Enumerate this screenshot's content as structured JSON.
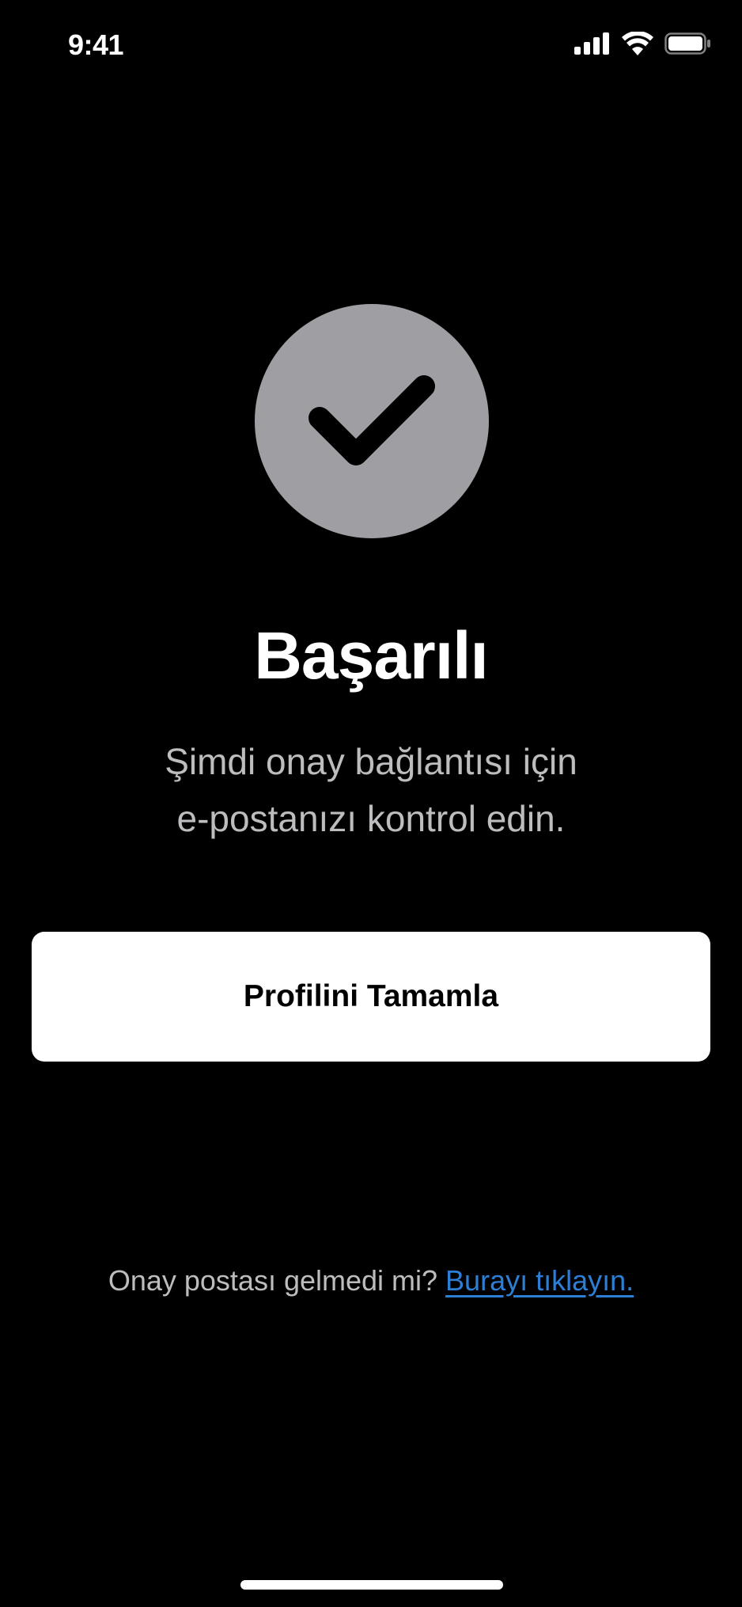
{
  "status_bar": {
    "time": "9:41",
    "icons": [
      "signal-icon",
      "wifi-icon",
      "battery-icon"
    ]
  },
  "success": {
    "icon": "checkmark-icon",
    "circle_color": "#9f9ea2",
    "title": "Başarılı",
    "subtitle_line1": "Şimdi onay bağlantısı için",
    "subtitle_line2": "e-postanızı kontrol edin."
  },
  "actions": {
    "primary_label": "Profilini Tamamla"
  },
  "footer": {
    "question": "Onay postası gelmedi mi?",
    "link_label": "Burayı tıklayın.",
    "link_color": "#2d7fd6"
  }
}
